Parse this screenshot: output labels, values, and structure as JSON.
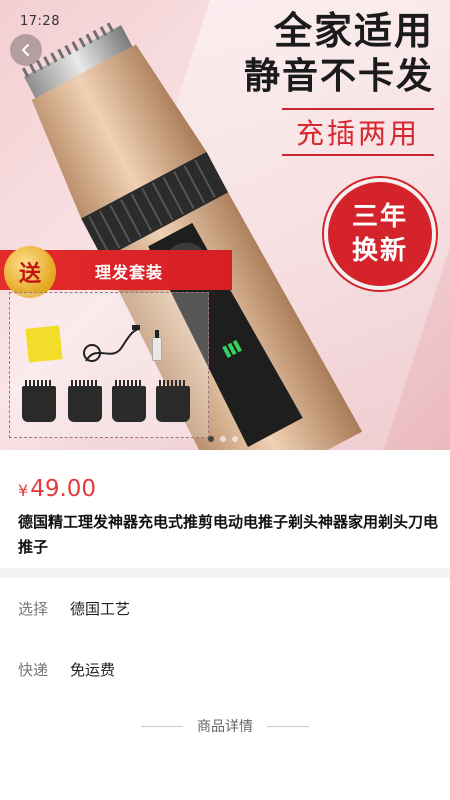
{
  "status_bar": {
    "time": "17:28"
  },
  "hero": {
    "headline_line1": "全家适用",
    "headline_line2": "静音不卡发",
    "headline_line3": "充插两用",
    "badge_line1": "三年",
    "badge_line2": "换新",
    "gift_label": "送",
    "kit_title": "理发套装",
    "carousel": {
      "count": 3,
      "active_index": 0
    }
  },
  "product": {
    "currency": "¥",
    "price": "49.00",
    "title": "德国精工理发神器充电式推剪电动电推子剃头神器家用剃头刀电推子"
  },
  "specs": [
    {
      "key": "选择",
      "value": "德国工艺"
    },
    {
      "key": "快递",
      "value": "免运费"
    }
  ],
  "details": {
    "heading": "商品详情"
  },
  "colors": {
    "price_red": "#e33b3b",
    "banner_red": "#d51f25",
    "clipper_gold": "#d9b28f"
  }
}
